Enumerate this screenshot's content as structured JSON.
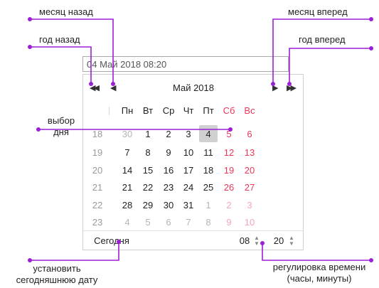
{
  "callouts": {
    "prev_month": "месяц назад",
    "next_month": "месяц вперед",
    "prev_year": "год назад",
    "next_year": "год вперед",
    "day_select_line1": "выбор",
    "day_select_line2": "дня",
    "set_today_line1": "установить",
    "set_today_line2": "сегодняшнюю дату",
    "time_adjust_line1": "регулировка времени",
    "time_adjust_line2": "(часы, минуты)"
  },
  "input": {
    "value": "04 Май 2018 08:20"
  },
  "calendar": {
    "month_title": "Май 2018",
    "prev_year_glyph": "◀◀",
    "prev_month_glyph": "◀",
    "next_month_glyph": "▶",
    "next_year_glyph": "▶▶",
    "weekdays": [
      "Пн",
      "Вт",
      "Ср",
      "Чт",
      "Пт",
      "Сб",
      "Вс"
    ],
    "weeks": [
      {
        "week": "18",
        "days": [
          "30",
          "1",
          "2",
          "3",
          "4",
          "5",
          "6"
        ]
      },
      {
        "week": "19",
        "days": [
          "7",
          "8",
          "9",
          "10",
          "11",
          "12",
          "13"
        ]
      },
      {
        "week": "20",
        "days": [
          "14",
          "15",
          "16",
          "17",
          "18",
          "19",
          "20"
        ]
      },
      {
        "week": "21",
        "days": [
          "21",
          "22",
          "23",
          "24",
          "25",
          "26",
          "27"
        ]
      },
      {
        "week": "22",
        "days": [
          "28",
          "29",
          "30",
          "31",
          "1",
          "2",
          "3"
        ]
      },
      {
        "week": "23",
        "days": [
          "4",
          "5",
          "6",
          "7",
          "8",
          "9",
          "10"
        ]
      }
    ],
    "selected_day": "4",
    "today_label": "Сегодня",
    "hours": "08",
    "minutes": "20"
  },
  "colors": {
    "callout_line": "#9b1fd6",
    "weekend": "#e8375a",
    "weekend_muted": "#f3a6b7",
    "muted": "#b5b5b5",
    "text": "#222222",
    "week_number": "#9a9a9a",
    "selected_bg": "#d0d0d0"
  },
  "icons": {
    "spinner_up": "▲",
    "spinner_down": "▼"
  }
}
